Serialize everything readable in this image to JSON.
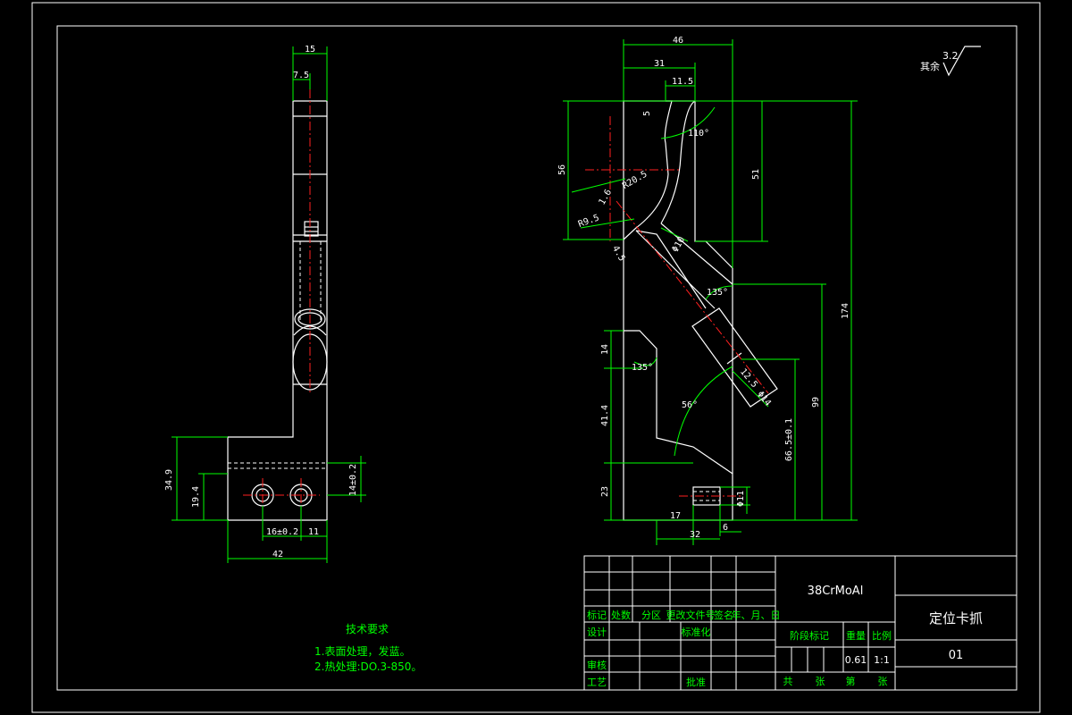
{
  "drawing": {
    "material": "38CrMoAl",
    "part_name": "定位卡抓",
    "drawing_no": "01",
    "mass": "0.61",
    "scale": "1:1",
    "surface_note": "其余",
    "surface_roughness": "3.2"
  },
  "notes": {
    "title": "技术要求",
    "items": [
      "1.表面处理，发蓝。",
      "2.热处理:DO.3-850。"
    ]
  },
  "title_block": {
    "labels": {
      "mark": "标记",
      "count": "处数",
      "zone": "分区",
      "change_doc": "更改文件号",
      "sign": "签名",
      "date": "年、月、日",
      "design": "设计",
      "standard": "标准化",
      "stage": "阶段标记",
      "weight": "重量",
      "ratio": "比例",
      "review": "审核",
      "process": "工艺",
      "approve": "批准",
      "total": "共",
      "sheets": "张",
      "no": "第",
      "sheet": "张"
    }
  },
  "left_view": {
    "dims": [
      "15",
      "7.5",
      "34.9",
      "19.4",
      "14±0.2",
      "16±0.2",
      "11",
      "42"
    ]
  },
  "right_view": {
    "dims": [
      "46",
      "31",
      "11.5",
      "5",
      "110°",
      "56",
      "51",
      "R20.5",
      "1.6",
      "R9.5",
      "Φ10",
      "4.5",
      "135°",
      "174",
      "135°",
      "14",
      "56°",
      "12.5",
      "Φ14",
      "41.4",
      "99",
      "66.5±0.1",
      "23",
      "Φ11",
      "17",
      "32",
      "6"
    ]
  }
}
